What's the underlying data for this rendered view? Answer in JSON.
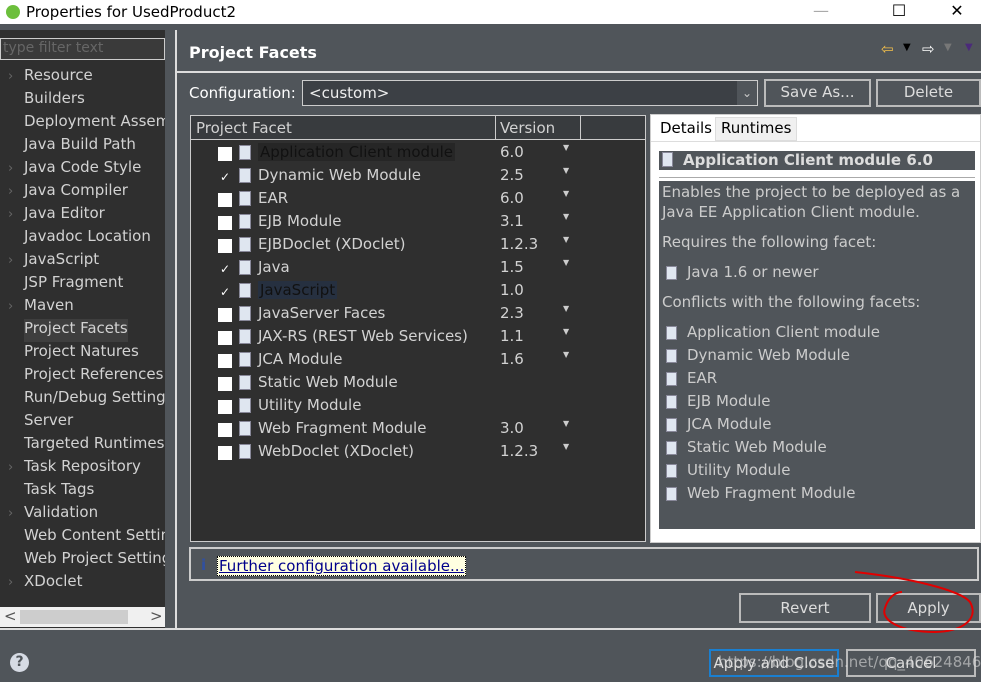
{
  "window": {
    "title": "Properties for UsedProduct2",
    "minimize": "—",
    "maximize": "☐",
    "close": "✕"
  },
  "sidebar": {
    "filter_placeholder": "type filter text",
    "items": [
      {
        "label": "Resource",
        "expandable": true
      },
      {
        "label": "Builders",
        "expandable": false
      },
      {
        "label": "Deployment Assem",
        "expandable": false
      },
      {
        "label": "Java Build Path",
        "expandable": false
      },
      {
        "label": "Java Code Style",
        "expandable": true
      },
      {
        "label": "Java Compiler",
        "expandable": true
      },
      {
        "label": "Java Editor",
        "expandable": true
      },
      {
        "label": "Javadoc Location",
        "expandable": false
      },
      {
        "label": "JavaScript",
        "expandable": true
      },
      {
        "label": "JSP Fragment",
        "expandable": false
      },
      {
        "label": "Maven",
        "expandable": true
      },
      {
        "label": "Project Facets",
        "expandable": false,
        "selected": true
      },
      {
        "label": "Project Natures",
        "expandable": false
      },
      {
        "label": "Project References",
        "expandable": false
      },
      {
        "label": "Run/Debug Setting",
        "expandable": false
      },
      {
        "label": "Server",
        "expandable": false
      },
      {
        "label": "Targeted Runtimes",
        "expandable": false
      },
      {
        "label": "Task Repository",
        "expandable": true
      },
      {
        "label": "Task Tags",
        "expandable": false
      },
      {
        "label": "Validation",
        "expandable": true
      },
      {
        "label": "Web Content Settin",
        "expandable": false
      },
      {
        "label": "Web Project Setting",
        "expandable": false
      },
      {
        "label": "XDoclet",
        "expandable": true
      }
    ],
    "scroll_left": "<",
    "scroll_right": ">"
  },
  "page": {
    "title": "Project Facets",
    "configuration_label": "Configuration:",
    "configuration_value": "<custom>",
    "save_as": "Save As...",
    "delete": "Delete"
  },
  "table": {
    "col_facet": "Project Facet",
    "col_version": "Version",
    "rows": [
      {
        "name": "Application Client module",
        "version": "6.0",
        "checked": false,
        "dropdown": true
      },
      {
        "name": "Dynamic Web Module",
        "version": "2.5",
        "checked": true,
        "dropdown": true
      },
      {
        "name": "EAR",
        "version": "6.0",
        "checked": false,
        "dropdown": true
      },
      {
        "name": "EJB Module",
        "version": "3.1",
        "checked": false,
        "dropdown": true
      },
      {
        "name": "EJBDoclet (XDoclet)",
        "version": "1.2.3",
        "checked": false,
        "dropdown": true
      },
      {
        "name": "Java",
        "version": "1.5",
        "checked": true,
        "dropdown": true
      },
      {
        "name": "JavaScript",
        "version": "1.0",
        "checked": true,
        "dropdown": false
      },
      {
        "name": "JavaServer Faces",
        "version": "2.3",
        "checked": false,
        "dropdown": true
      },
      {
        "name": "JAX-RS (REST Web Services)",
        "version": "1.1",
        "checked": false,
        "dropdown": true
      },
      {
        "name": "JCA Module",
        "version": "1.6",
        "checked": false,
        "dropdown": true
      },
      {
        "name": "Static Web Module",
        "version": "",
        "checked": false,
        "dropdown": false
      },
      {
        "name": "Utility Module",
        "version": "",
        "checked": false,
        "dropdown": false
      },
      {
        "name": "Web Fragment Module",
        "version": "3.0",
        "checked": false,
        "dropdown": true
      },
      {
        "name": "WebDoclet (XDoclet)",
        "version": "1.2.3",
        "checked": false,
        "dropdown": true
      }
    ]
  },
  "details": {
    "tab_details": "Details",
    "tab_runtimes": "Runtimes",
    "heading": "Application Client module 6.0",
    "description_1": "Enables the project to be deployed as a",
    "description_2": "Java EE Application Client module.",
    "requires_label": "Requires the following facet:",
    "requires": [
      "Java 1.6 or newer"
    ],
    "conflicts_label": "Conflicts with the following facets:",
    "conflicts": [
      "Application Client module",
      "Dynamic Web Module",
      "EAR",
      "EJB Module",
      "JCA Module",
      "Static Web Module",
      "Utility Module",
      "Web Fragment Module"
    ]
  },
  "further_link": "Further configuration available...",
  "buttons": {
    "revert": "Revert",
    "apply": "Apply",
    "apply_close": "Apply and Close",
    "cancel": "Cancel"
  },
  "watermark": "https://blog.csdn.net/qq_40624846",
  "colors": {
    "background": "#50555a",
    "panel": "#2f2f2f",
    "annotation": "#e00000",
    "link": "#00008b"
  }
}
